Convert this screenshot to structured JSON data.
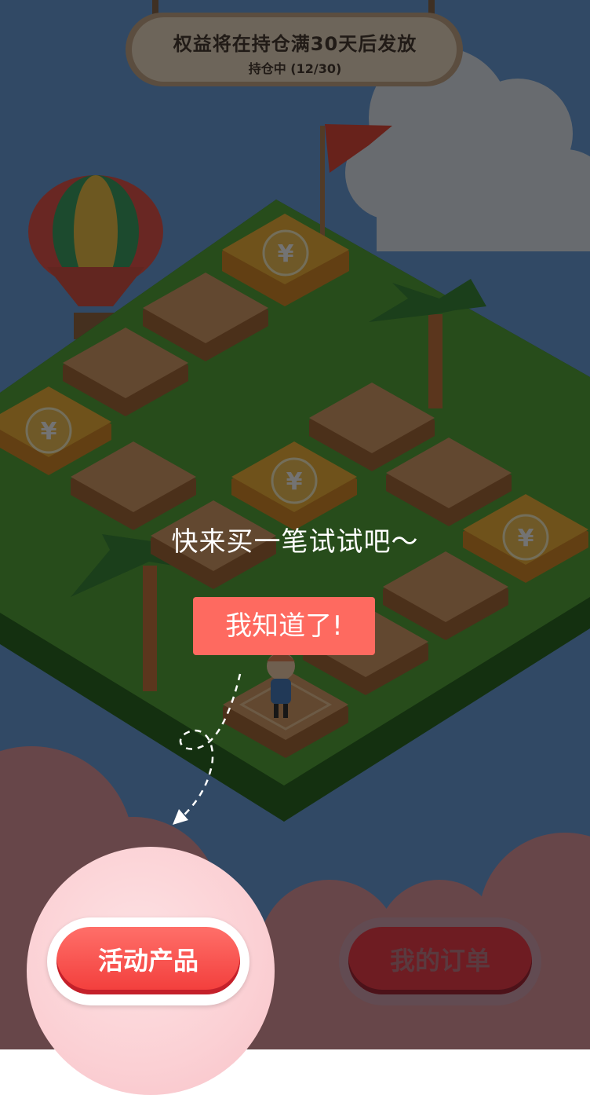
{
  "banner": {
    "title": "权益将在持仓满30天后发放",
    "progress": "持仓中 (12/30)"
  },
  "guide": {
    "tip": "快来买一笔试试吧～",
    "ok_button": "我知道了!"
  },
  "board": {
    "coin_symbol": "¥"
  },
  "bottom": {
    "activity_button": "活动产品",
    "orders_button": "我的订单"
  },
  "colors": {
    "accent": "#fe6a60",
    "button_red": "#f23c3a",
    "board_green": "#3a7d2c",
    "sky": "#5b86c8"
  }
}
